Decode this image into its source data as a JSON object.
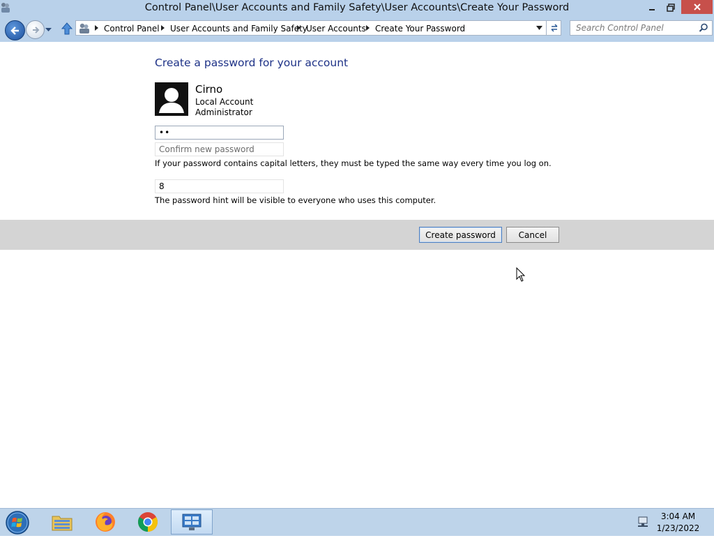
{
  "window": {
    "title": "Control Panel\\User Accounts and Family Safety\\User Accounts\\Create Your Password",
    "minimize_glyph": "—",
    "restore_glyph": "❐",
    "close_glyph": "✕"
  },
  "nav": {
    "breadcrumbs": [
      "Control Panel",
      "User Accounts and Family Safety",
      "User Accounts",
      "Create Your Password"
    ],
    "search_placeholder": "Search Control Panel"
  },
  "page": {
    "heading": "Create a password for your account",
    "user": {
      "name": "Cirno",
      "account_type": "Local Account",
      "role": "Administrator"
    },
    "new_password_value": "••",
    "confirm_placeholder": "Confirm new password",
    "capital_note": "If your password contains capital letters, they must be typed the same way every time you log on.",
    "hint_value": "8",
    "hint_note": "The password hint will be visible to everyone who uses this computer.",
    "buttons": {
      "create": "Create password",
      "cancel": "Cancel"
    }
  },
  "taskbar": {
    "items": [
      "start-orb-icon",
      "file-explorer-icon",
      "firefox-icon",
      "chrome-icon",
      "control-panel-icon"
    ],
    "clock": {
      "time": "3:04 AM",
      "date": "1/23/2022"
    }
  },
  "colors": {
    "chrome": "#b9d1ea",
    "heading": "#1e3287",
    "close": "#c7504b",
    "button_band": "#d4d4d4",
    "taskbar": "#bed4ea"
  }
}
